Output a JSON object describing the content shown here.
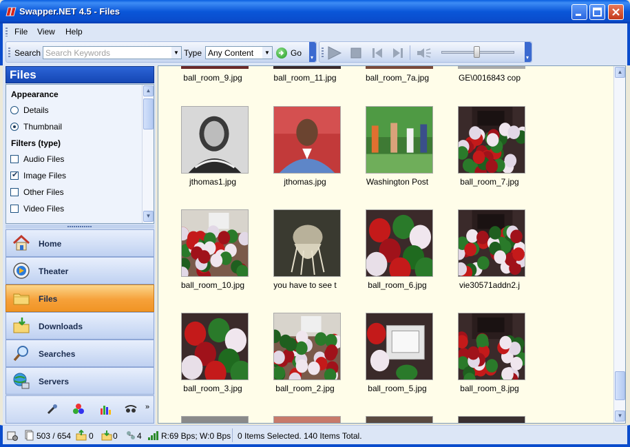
{
  "window": {
    "title": "Swapper.NET 4.5 - Files"
  },
  "menu": {
    "items": [
      "File",
      "View",
      "Help"
    ]
  },
  "toolbar": {
    "search_label": "Search",
    "search_placeholder": "Search Keywords",
    "type_label": "Type",
    "type_value": "Any Content",
    "go_label": "Go",
    "volume_level": 0.5
  },
  "sidebar": {
    "header": "Files",
    "appearance_heading": "Appearance",
    "appearance_options": [
      {
        "label": "Details",
        "selected": false
      },
      {
        "label": "Thumbnail",
        "selected": true
      }
    ],
    "filters_heading": "Filters (type)",
    "filters": [
      {
        "label": "Audio Files",
        "checked": false
      },
      {
        "label": "Image Files",
        "checked": true
      },
      {
        "label": "Other Files",
        "checked": false
      },
      {
        "label": "Video Files",
        "checked": false
      }
    ],
    "nav": [
      {
        "label": "Home",
        "icon": "home-icon",
        "active": false
      },
      {
        "label": "Theater",
        "icon": "theater-icon",
        "active": false
      },
      {
        "label": "Files",
        "icon": "folder-icon",
        "active": true
      },
      {
        "label": "Downloads",
        "icon": "downloads-icon",
        "active": false
      },
      {
        "label": "Searches",
        "icon": "magnifier-icon",
        "active": false
      },
      {
        "label": "Servers",
        "icon": "servers-icon",
        "active": false
      }
    ]
  },
  "files": {
    "top_row_captions": [
      "ball_room_9.jpg",
      "ball_room_11.jpg",
      "ball_room_7a.jpg",
      "GE\\0016843 cop"
    ],
    "rows": [
      [
        {
          "caption": "jthomas1.jpg",
          "art": "inverted"
        },
        {
          "caption": "jthomas.jpg",
          "art": "portrait"
        },
        {
          "caption": "Washington Post",
          "art": "outdoor"
        },
        {
          "caption": "ball_room_7.jpg",
          "art": "balloons_dark"
        }
      ],
      [
        {
          "caption": "ball_room_10.jpg",
          "art": "balloons"
        },
        {
          "caption": "you have to see t",
          "art": "creature"
        },
        {
          "caption": "ball_room_6.jpg",
          "art": "balloons_close"
        },
        {
          "caption": "vie30571addn2.j",
          "art": "balloons_dark"
        }
      ],
      [
        {
          "caption": "ball_room_3.jpg",
          "art": "balloons_close"
        },
        {
          "caption": "ball_room_2.jpg",
          "art": "balloons"
        },
        {
          "caption": "ball_room_5.jpg",
          "art": "monitor"
        },
        {
          "caption": "ball_room_8.jpg",
          "art": "balloons_dark"
        }
      ]
    ]
  },
  "status": {
    "count": "503 / 654",
    "uploads": "0",
    "downloads": "0",
    "peers": "4",
    "rate": "R:69 Bps; W:0 Bps",
    "selection": "0 Items Selected. 140 Items Total."
  },
  "colors": {
    "accent": "#0a4ccc",
    "active_nav": "#f6a13a",
    "content_bg": "#fffde9"
  }
}
